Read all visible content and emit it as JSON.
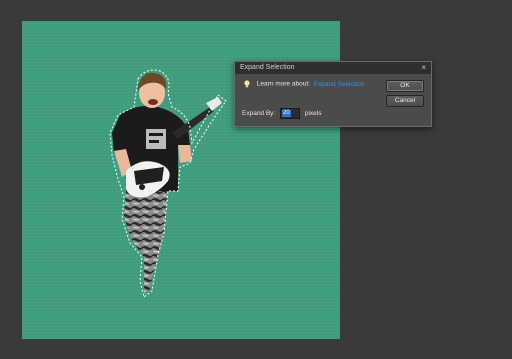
{
  "dialog": {
    "title": "Expand Selection",
    "close_glyph": "×",
    "learn_text": "Learn more about:",
    "learn_link": "Expand Selection",
    "ok_label": "OK",
    "cancel_label": "Cancel",
    "expand_label": "Expand By:",
    "expand_value": "20",
    "unit_label": "pixels"
  },
  "canvas": {
    "background_color": "#3f9e80",
    "subject": "boy-playing-guitar-selection"
  },
  "icons": {
    "tip": "lightbulb-icon"
  }
}
